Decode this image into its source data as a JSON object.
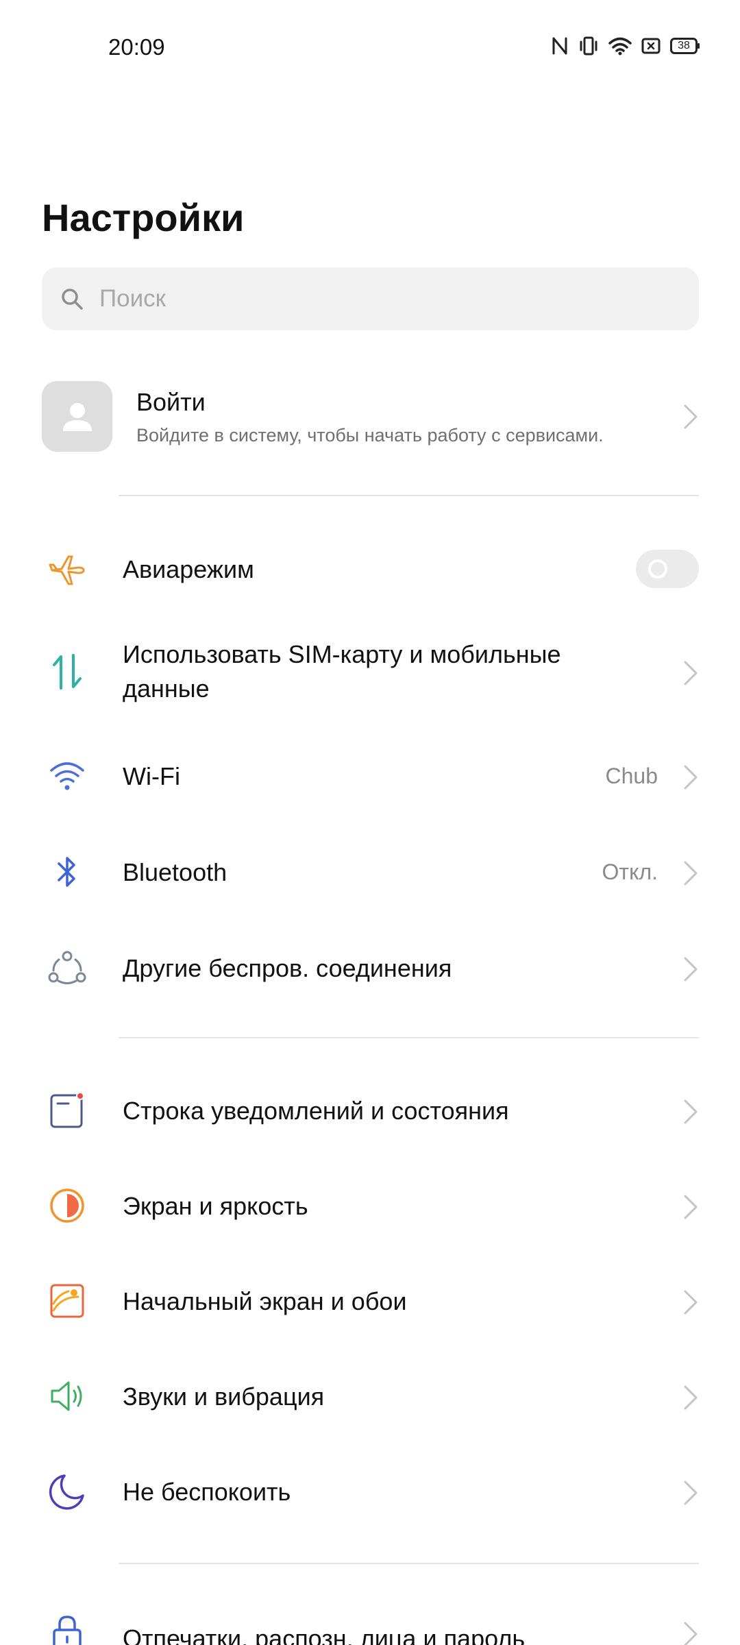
{
  "status_bar": {
    "time": "20:09",
    "icons": [
      "nfc-icon",
      "vibrate-icon",
      "wifi-signal-icon",
      "sim-off-icon",
      "battery-icon"
    ],
    "battery_level": "38"
  },
  "title": "Настройки",
  "search": {
    "placeholder": "Поиск"
  },
  "account": {
    "title": "Войти",
    "subtitle": "Войдите в систему, чтобы начать работу с сервисами."
  },
  "connectivity": [
    {
      "label": "Авиарежим",
      "icon": "airplane-icon",
      "control": "toggle",
      "toggle_on": false,
      "color": "#f0952c"
    },
    {
      "label_line1": "Использовать SIM-карту и мобильные",
      "label_line2": "данные",
      "icon": "mobile-data-icon",
      "color": "#2bb3a3"
    },
    {
      "label": "Wi-Fi",
      "value": "Chub",
      "icon": "wifi-icon",
      "color": "#4a6fd9"
    },
    {
      "label": "Bluetooth",
      "value": "Откл.",
      "icon": "bluetooth-icon",
      "color": "#3e63d6"
    },
    {
      "label": "Другие беспров. соединения",
      "icon": "connections-icon",
      "color": "#7c8797"
    }
  ],
  "display": [
    {
      "label": "Строка уведомлений и состояния",
      "icon": "notification-bar-icon",
      "color": "#4a5a8a"
    },
    {
      "label": "Экран и яркость",
      "icon": "brightness-icon",
      "color": "#f0952c"
    },
    {
      "label": "Начальный экран и обои",
      "icon": "wallpaper-icon",
      "color": "#e8663a"
    },
    {
      "label": "Звуки и вибрация",
      "icon": "sound-icon",
      "color": "#3fae63"
    },
    {
      "label": "Не беспокоить",
      "icon": "moon-icon",
      "color": "#4a3fb8"
    }
  ],
  "security": [
    {
      "label": "Отпечатки, распозн. лица и пароль",
      "icon": "lock-icon",
      "color": "#3e63d6"
    }
  ]
}
